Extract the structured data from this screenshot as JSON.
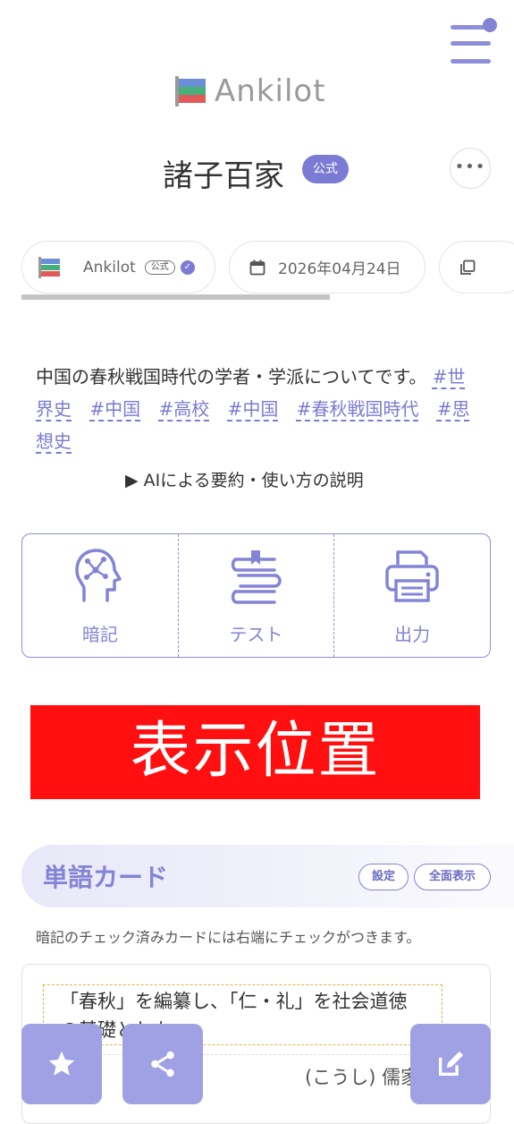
{
  "header": {
    "logo_text": "Ankilot",
    "logo_colors": [
      "#6a8fd6",
      "#47b07a",
      "#e05a5a"
    ]
  },
  "title": {
    "text": "諸子百家",
    "badge": "公式",
    "more_icon": "ellipsis-icon"
  },
  "meta": {
    "author": "Ankilot",
    "author_badge": "公式",
    "date": "2026年04月24日",
    "copy_icon": "copy-icon"
  },
  "description": {
    "text": "中国の春秋戦国時代の学者・学派についてです。",
    "tags": [
      "#世界史",
      "#中国",
      "#高校",
      "#中国",
      "#春秋戦国時代",
      "#思想史"
    ]
  },
  "summary_toggle": "▶ AIによる要約・使い方の説明",
  "actions": [
    {
      "label": "暗記",
      "icon": "brain-icon"
    },
    {
      "label": "テスト",
      "icon": "book-stack-icon"
    },
    {
      "label": "出力",
      "icon": "printer-icon"
    }
  ],
  "ad": {
    "label": "表示位置",
    "color": "#ff0f0f"
  },
  "section": {
    "title": "単語カード",
    "settings_label": "設定",
    "show_all_label": "全面表示"
  },
  "note": "暗記のチェック済みカードには右端にチェックがつきます。",
  "card": {
    "front": "「春秋」を編纂し、「仁・礼」を社会道徳の基礎とした。",
    "back": "(こうし) 儒家"
  },
  "fabs": {
    "star_icon": "star-icon",
    "share_icon": "share-icon",
    "edit_icon": "edit-icon"
  },
  "colors": {
    "accent": "#8484d6",
    "fab": "#a0a0e4"
  }
}
